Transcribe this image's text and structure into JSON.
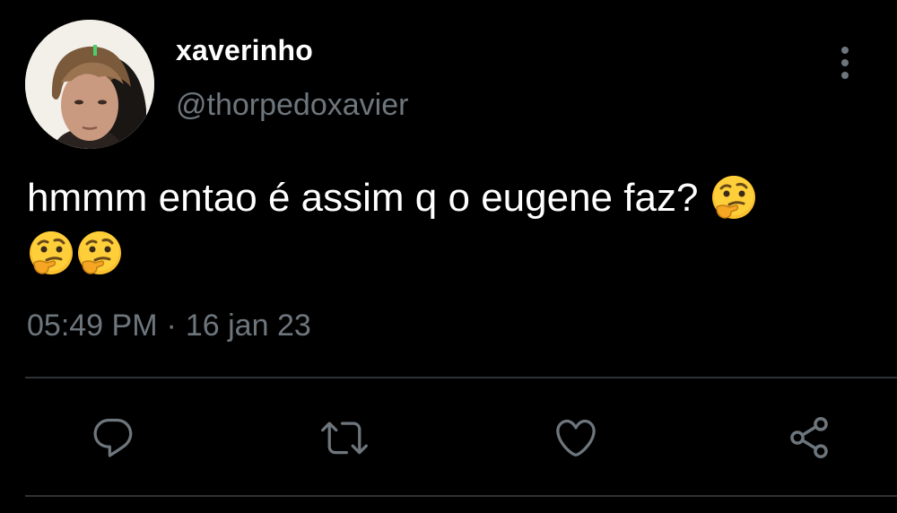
{
  "tweet": {
    "author": {
      "display_name": "xaverinho",
      "handle": "@thorpedoxavier",
      "avatar_icon": "user-avatar-photo"
    },
    "text_line1": "hmmm entao é assim q o eugene faz?",
    "emoji": "thinking-face",
    "emoji_count": 3,
    "time": "05:49 PM",
    "separator": "·",
    "date": "16 jan 23"
  },
  "actions": {
    "reply_icon": "reply-icon",
    "retweet_icon": "retweet-icon",
    "like_icon": "heart-icon",
    "share_icon": "share-icon"
  },
  "menu_icon": "more-options-icon",
  "colors": {
    "background": "#000000",
    "text": "#ffffff",
    "secondary_text": "#6e767d",
    "divider": "#2f3336"
  }
}
